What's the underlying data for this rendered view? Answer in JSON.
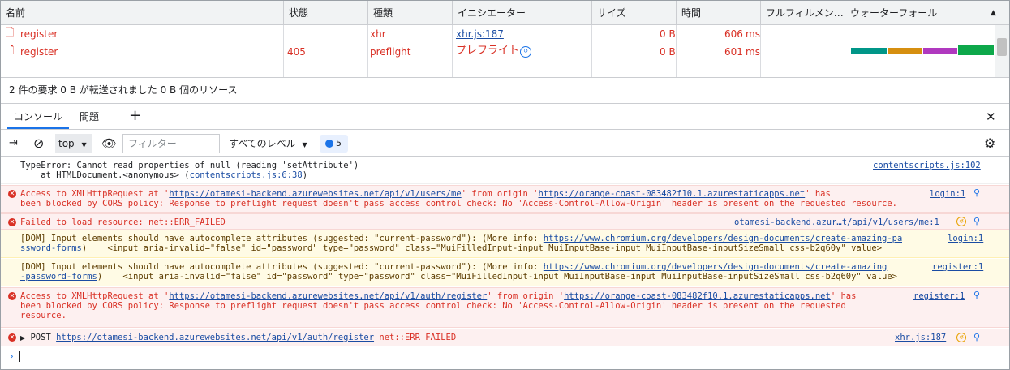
{
  "network": {
    "columns": [
      "名前",
      "状態",
      "種類",
      "イニシエーター",
      "サイズ",
      "時間",
      "フルフィルメン…",
      "ウォーターフォール"
    ],
    "sort_icon": "sort-up-icon",
    "rows": [
      {
        "name": "register",
        "status": "",
        "type": "xhr",
        "initiator": "xhr.js:187",
        "size": "0 B",
        "time": "606",
        "time_unit": "ms"
      },
      {
        "name": "register",
        "status": "405",
        "type": "preflight",
        "initiator": "プレフライト",
        "size": "0 B",
        "time": "601",
        "time_unit": "ms"
      }
    ],
    "waterfall_colors": [
      "#009688",
      "#d68f10",
      "#b039bf",
      "#0da84a"
    ],
    "summary": "2 件の要求  0 B が転送されました  0 B 個のリソース"
  },
  "drawer": {
    "tabs": [
      "コンソール",
      "問題"
    ],
    "add_icon": "+",
    "close_icon": "✕"
  },
  "console_toolbar": {
    "context": "top",
    "filter_placeholder": "フィルター",
    "levels": "すべてのレベル",
    "message_count": "5"
  },
  "messages": [
    {
      "kind": "plain",
      "lines": [
        "TypeError: Cannot read properties of null (reading 'setAttribute')",
        "    at HTMLDocument.<anonymous> ("
      ],
      "inline_link": "contentscripts.js:6:38",
      "tail": ")",
      "source": "contentscripts.js:102"
    },
    {
      "kind": "err",
      "pre": "Access to XMLHttpRequest at '",
      "url1": "https://otamesi-backend.azurewebsites.net/api/v1/users/me",
      "mid": "' from origin '",
      "url2": "https://orange-coast-083482f10.1.azurestaticapps.net",
      "post": "' has",
      "line2": "been blocked by CORS policy: Response to preflight request doesn't pass access control check: No 'Access-Control-Allow-Origin' header is present on the requested resource.",
      "source": "login:1"
    },
    {
      "kind": "err",
      "text": "Failed to load resource: net::ERR_FAILED",
      "source": "otamesi-backend.azur…t/api/v1/users/me:1"
    },
    {
      "kind": "warn",
      "pre": "[DOM] Input elements should have autocomplete attributes (suggested: \"current-password\"): (More info: ",
      "url1": "https://www.chromium.org/developers/design-documents/create-amazing-pa",
      "url1b": "ssword-forms",
      "post": ")    <input aria-invalid=\"false\" id=\"password\" type=\"password\" class=\"MuiFilledInput-input MuiInputBase-input MuiInputBase-inputSizeSmall css-b2q60y\" value>",
      "source": "login:1"
    },
    {
      "kind": "warn",
      "pre": "[DOM] Input elements should have autocomplete attributes (suggested: \"current-password\"): (More info: ",
      "url1": "https://www.chromium.org/developers/design-documents/create-amazing",
      "url1b": "-password-forms",
      "post": ")    <input aria-invalid=\"false\" id=\"password\" type=\"password\" class=\"MuiFilledInput-input MuiInputBase-input MuiInputBase-inputSizeSmall css-b2q60y\" value>",
      "source": "register:1"
    },
    {
      "kind": "err",
      "pre": "Access to XMLHttpRequest at '",
      "url1": "https://otamesi-backend.azurewebsites.net/api/v1/auth/register",
      "mid": "' from origin '",
      "url2": "https://orange-coast-083482f10.1.azurestaticapps.net",
      "post": "' has",
      "line2": "been blocked by CORS policy: Response to preflight request doesn't pass access control check: No 'Access-Control-Allow-Origin' header is present on the requested",
      "line3": "resource.",
      "source": "register:1"
    },
    {
      "kind": "err",
      "method": "POST",
      "url1": "https://otamesi-backend.azurewebsites.net/api/v1/auth/register",
      "post": "net::ERR_FAILED",
      "source": "xhr.js:187"
    }
  ],
  "colors": {
    "error": "#d93025",
    "warning_bg": "#fffbe5",
    "error_bg": "#fdf0f0",
    "link": "#1a4ca3",
    "accent": "#1a73e8"
  }
}
